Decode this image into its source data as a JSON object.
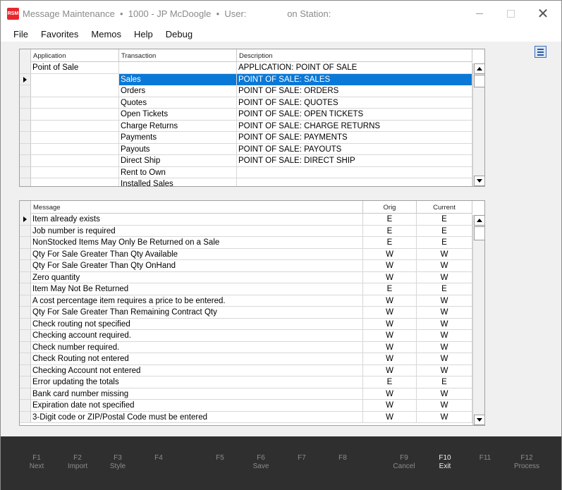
{
  "titlebar": {
    "title": "Message Maintenance  •  1000 - JP McDoogle  •  User:                on Station:",
    "logo_text": "RSM"
  },
  "menu": [
    "File",
    "Favorites",
    "Memos",
    "Help",
    "Debug"
  ],
  "transaction_grid": {
    "headers": [
      "Application",
      "Transaction",
      "Description"
    ],
    "rows": [
      {
        "application": "Point of Sale",
        "transaction": "",
        "description": "APPLICATION: POINT OF SALE",
        "current": false,
        "selected": false
      },
      {
        "application": "",
        "transaction": "Sales",
        "description": "POINT OF SALE: SALES",
        "current": true,
        "selected": true
      },
      {
        "application": "",
        "transaction": "Orders",
        "description": "POINT OF SALE: ORDERS",
        "current": false,
        "selected": false
      },
      {
        "application": "",
        "transaction": "Quotes",
        "description": "POINT OF SALE: QUOTES",
        "current": false,
        "selected": false
      },
      {
        "application": "",
        "transaction": "Open Tickets",
        "description": "POINT OF SALE: OPEN TICKETS",
        "current": false,
        "selected": false
      },
      {
        "application": "",
        "transaction": "Charge Returns",
        "description": "POINT OF SALE: CHARGE RETURNS",
        "current": false,
        "selected": false
      },
      {
        "application": "",
        "transaction": "Payments",
        "description": "POINT OF SALE: PAYMENTS",
        "current": false,
        "selected": false
      },
      {
        "application": "",
        "transaction": "Payouts",
        "description": "POINT OF SALE: PAYOUTS",
        "current": false,
        "selected": false
      },
      {
        "application": "",
        "transaction": "Direct Ship",
        "description": "POINT OF SALE: DIRECT SHIP",
        "current": false,
        "selected": false
      },
      {
        "application": "",
        "transaction": "Rent to Own",
        "description": "",
        "current": false,
        "selected": false
      },
      {
        "application": "",
        "transaction": "Installed Sales",
        "description": "",
        "current": false,
        "selected": false
      }
    ]
  },
  "message_grid": {
    "headers": [
      "Message",
      "Orig",
      "Current"
    ],
    "rows": [
      {
        "message": "Item already exists",
        "orig": "E",
        "current_value": "E",
        "current": true
      },
      {
        "message": "Job number is required",
        "orig": "E",
        "current_value": "E",
        "current": false
      },
      {
        "message": "NonStocked Items May Only Be Returned on a Sale",
        "orig": "E",
        "current_value": "E",
        "current": false
      },
      {
        "message": "Qty For Sale Greater Than Qty Available",
        "orig": "W",
        "current_value": "W",
        "current": false
      },
      {
        "message": "Qty For Sale Greater Than Qty OnHand",
        "orig": "W",
        "current_value": "W",
        "current": false
      },
      {
        "message": "Zero quantity",
        "orig": "W",
        "current_value": "W",
        "current": false
      },
      {
        "message": "Item May Not Be Returned",
        "orig": "E",
        "current_value": "E",
        "current": false
      },
      {
        "message": "A cost percentage item requires a price to be entered.",
        "orig": "W",
        "current_value": "W",
        "current": false
      },
      {
        "message": "Qty For Sale Greater Than Remaining Contract Qty",
        "orig": "W",
        "current_value": "W",
        "current": false
      },
      {
        "message": "Check routing not specified",
        "orig": "W",
        "current_value": "W",
        "current": false
      },
      {
        "message": "Checking account required.",
        "orig": "W",
        "current_value": "W",
        "current": false
      },
      {
        "message": "Check number required.",
        "orig": "W",
        "current_value": "W",
        "current": false
      },
      {
        "message": "Check Routing not entered",
        "orig": "W",
        "current_value": "W",
        "current": false
      },
      {
        "message": "Checking Account not entered",
        "orig": "W",
        "current_value": "W",
        "current": false
      },
      {
        "message": "Error updating the totals",
        "orig": "E",
        "current_value": "E",
        "current": false
      },
      {
        "message": "Bank card number missing",
        "orig": "W",
        "current_value": "W",
        "current": false
      },
      {
        "message": "Expiration date not specified",
        "orig": "W",
        "current_value": "W",
        "current": false
      },
      {
        "message": "3-Digit code or ZIP/Postal Code must be entered",
        "orig": "W",
        "current_value": "W",
        "current": false
      }
    ]
  },
  "function_keys": [
    {
      "key": "F1",
      "label": "Next",
      "active": false
    },
    {
      "key": "F2",
      "label": "Import",
      "active": false
    },
    {
      "key": "F3",
      "label": "Style",
      "active": false
    },
    {
      "key": "F4",
      "label": "",
      "active": false
    },
    {
      "key": "F5",
      "label": "",
      "active": false
    },
    {
      "key": "F6",
      "label": "Save",
      "active": false
    },
    {
      "key": "F7",
      "label": "",
      "active": false
    },
    {
      "key": "F8",
      "label": "",
      "active": false
    },
    {
      "key": "F9",
      "label": "Cancel",
      "active": false
    },
    {
      "key": "F10",
      "label": "Exit",
      "active": true
    },
    {
      "key": "F11",
      "label": "",
      "active": false
    },
    {
      "key": "F12",
      "label": "Process",
      "active": false
    }
  ],
  "colors": {
    "selection": "#0a78d7",
    "fkey_bar": "#2f2f2f",
    "logo": "#e8262d"
  }
}
